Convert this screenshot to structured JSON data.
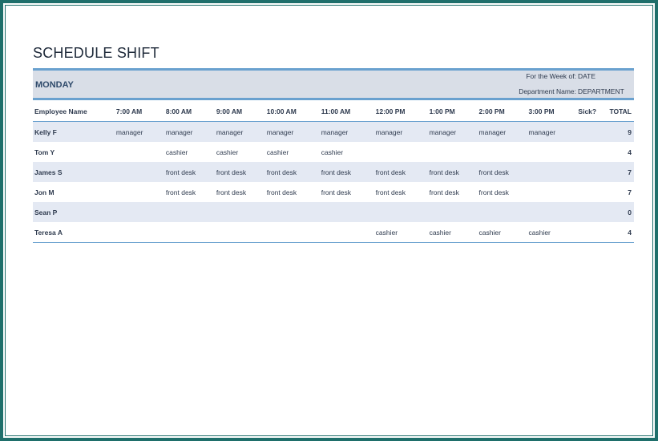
{
  "title": "SCHEDULE SHIFT",
  "day": "MONDAY",
  "week_label": "For the Week of:",
  "week_value": "DATE",
  "dept_label": "Department Name:",
  "dept_value": "DEPARTMENT",
  "columns": [
    "Employee Name",
    "7:00 AM",
    "8:00 AM",
    "9:00 AM",
    "10:00 AM",
    "11:00 AM",
    "12:00 PM",
    "1:00 PM",
    "2:00 PM",
    "3:00 PM",
    "Sick?",
    "TOTAL"
  ],
  "rows": [
    {
      "name": "Kelly F",
      "cells": [
        "manager",
        "manager",
        "manager",
        "manager",
        "manager",
        "manager",
        "manager",
        "manager",
        "manager"
      ],
      "sick": "",
      "total": "9"
    },
    {
      "name": "Tom Y",
      "cells": [
        "",
        "cashier",
        "cashier",
        "cashier",
        "cashier",
        "",
        "",
        "",
        ""
      ],
      "sick": "",
      "total": "4"
    },
    {
      "name": "James S",
      "cells": [
        "",
        "front desk",
        "front desk",
        "front desk",
        "front desk",
        "front desk",
        "front desk",
        "front desk",
        ""
      ],
      "sick": "",
      "total": "7"
    },
    {
      "name": "Jon M",
      "cells": [
        "",
        "front desk",
        "front desk",
        "front desk",
        "front desk",
        "front desk",
        "front desk",
        "front desk",
        ""
      ],
      "sick": "",
      "total": "7"
    },
    {
      "name": "Sean P",
      "cells": [
        "",
        "",
        "",
        "",
        "",
        "",
        "",
        "",
        ""
      ],
      "sick": "",
      "total": "0"
    },
    {
      "name": "Teresa A",
      "cells": [
        "",
        "",
        "",
        "",
        "",
        "cashier",
        "cashier",
        "cashier",
        "cashier"
      ],
      "sick": "",
      "total": "4"
    }
  ],
  "colors": {
    "frame": "#1f6f6b",
    "accent": "#6aa1cf",
    "band": "#d9dee7",
    "alt_row": "#e4e9f3"
  }
}
